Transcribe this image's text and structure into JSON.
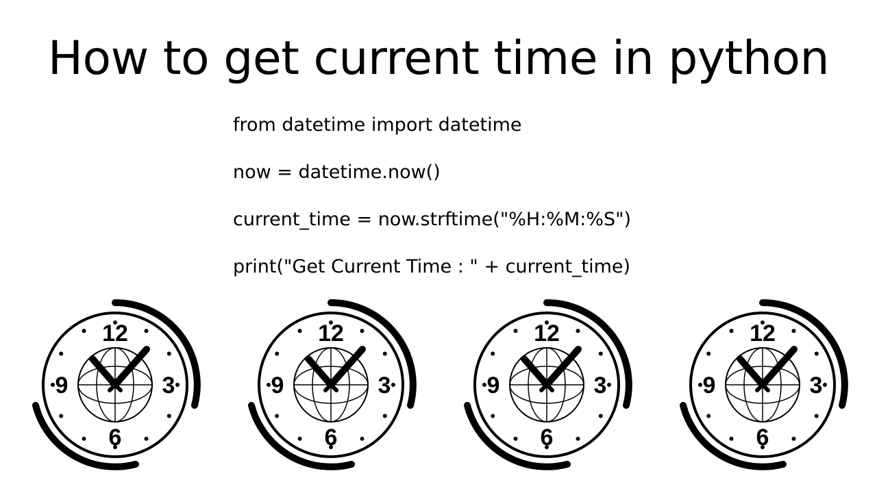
{
  "title": "How to get current time in python",
  "code": {
    "line1": "from datetime import datetime",
    "line2": "now = datetime.now()",
    "line3": "current_time = now.strftime(\"%H:%M:%S\")",
    "line4": "print(\"Get Current Time : \" + current_time)"
  },
  "clock_face": {
    "n12": "12",
    "n3": "3",
    "n6": "6",
    "n9": "9"
  }
}
